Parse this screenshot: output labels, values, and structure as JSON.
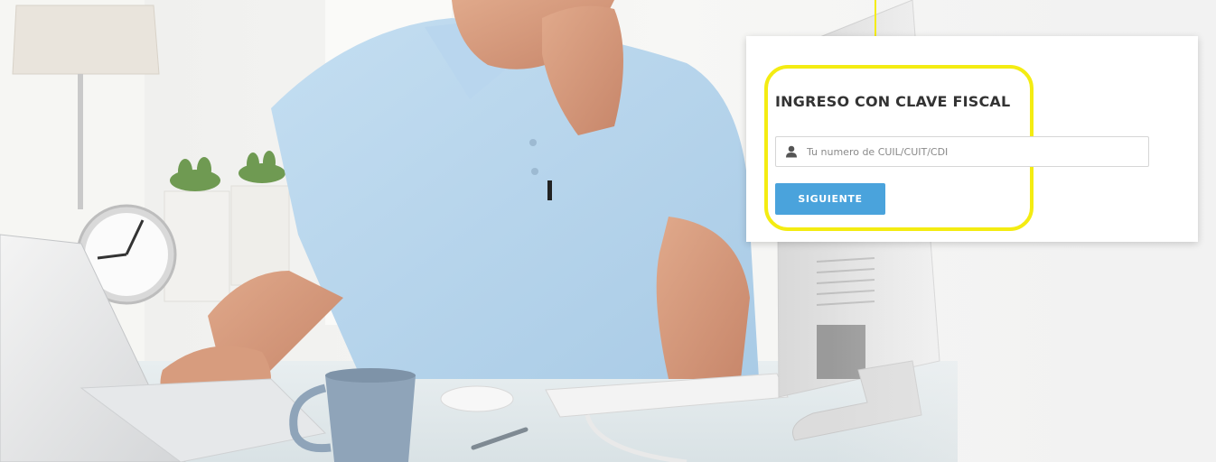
{
  "login": {
    "title": "INGRESO CON CLAVE FISCAL",
    "id_placeholder": "Tu numero de CUIL/CUIT/CDI",
    "id_value": "",
    "next_label": "SIGUIENTE"
  },
  "icons": {
    "input_icon": "user-icon",
    "pointer": "arrow-down-icon"
  },
  "colors": {
    "highlight": "#f4ec12",
    "button": "#4aa3dc",
    "card_background": "#ffffff",
    "title": "#333333"
  }
}
